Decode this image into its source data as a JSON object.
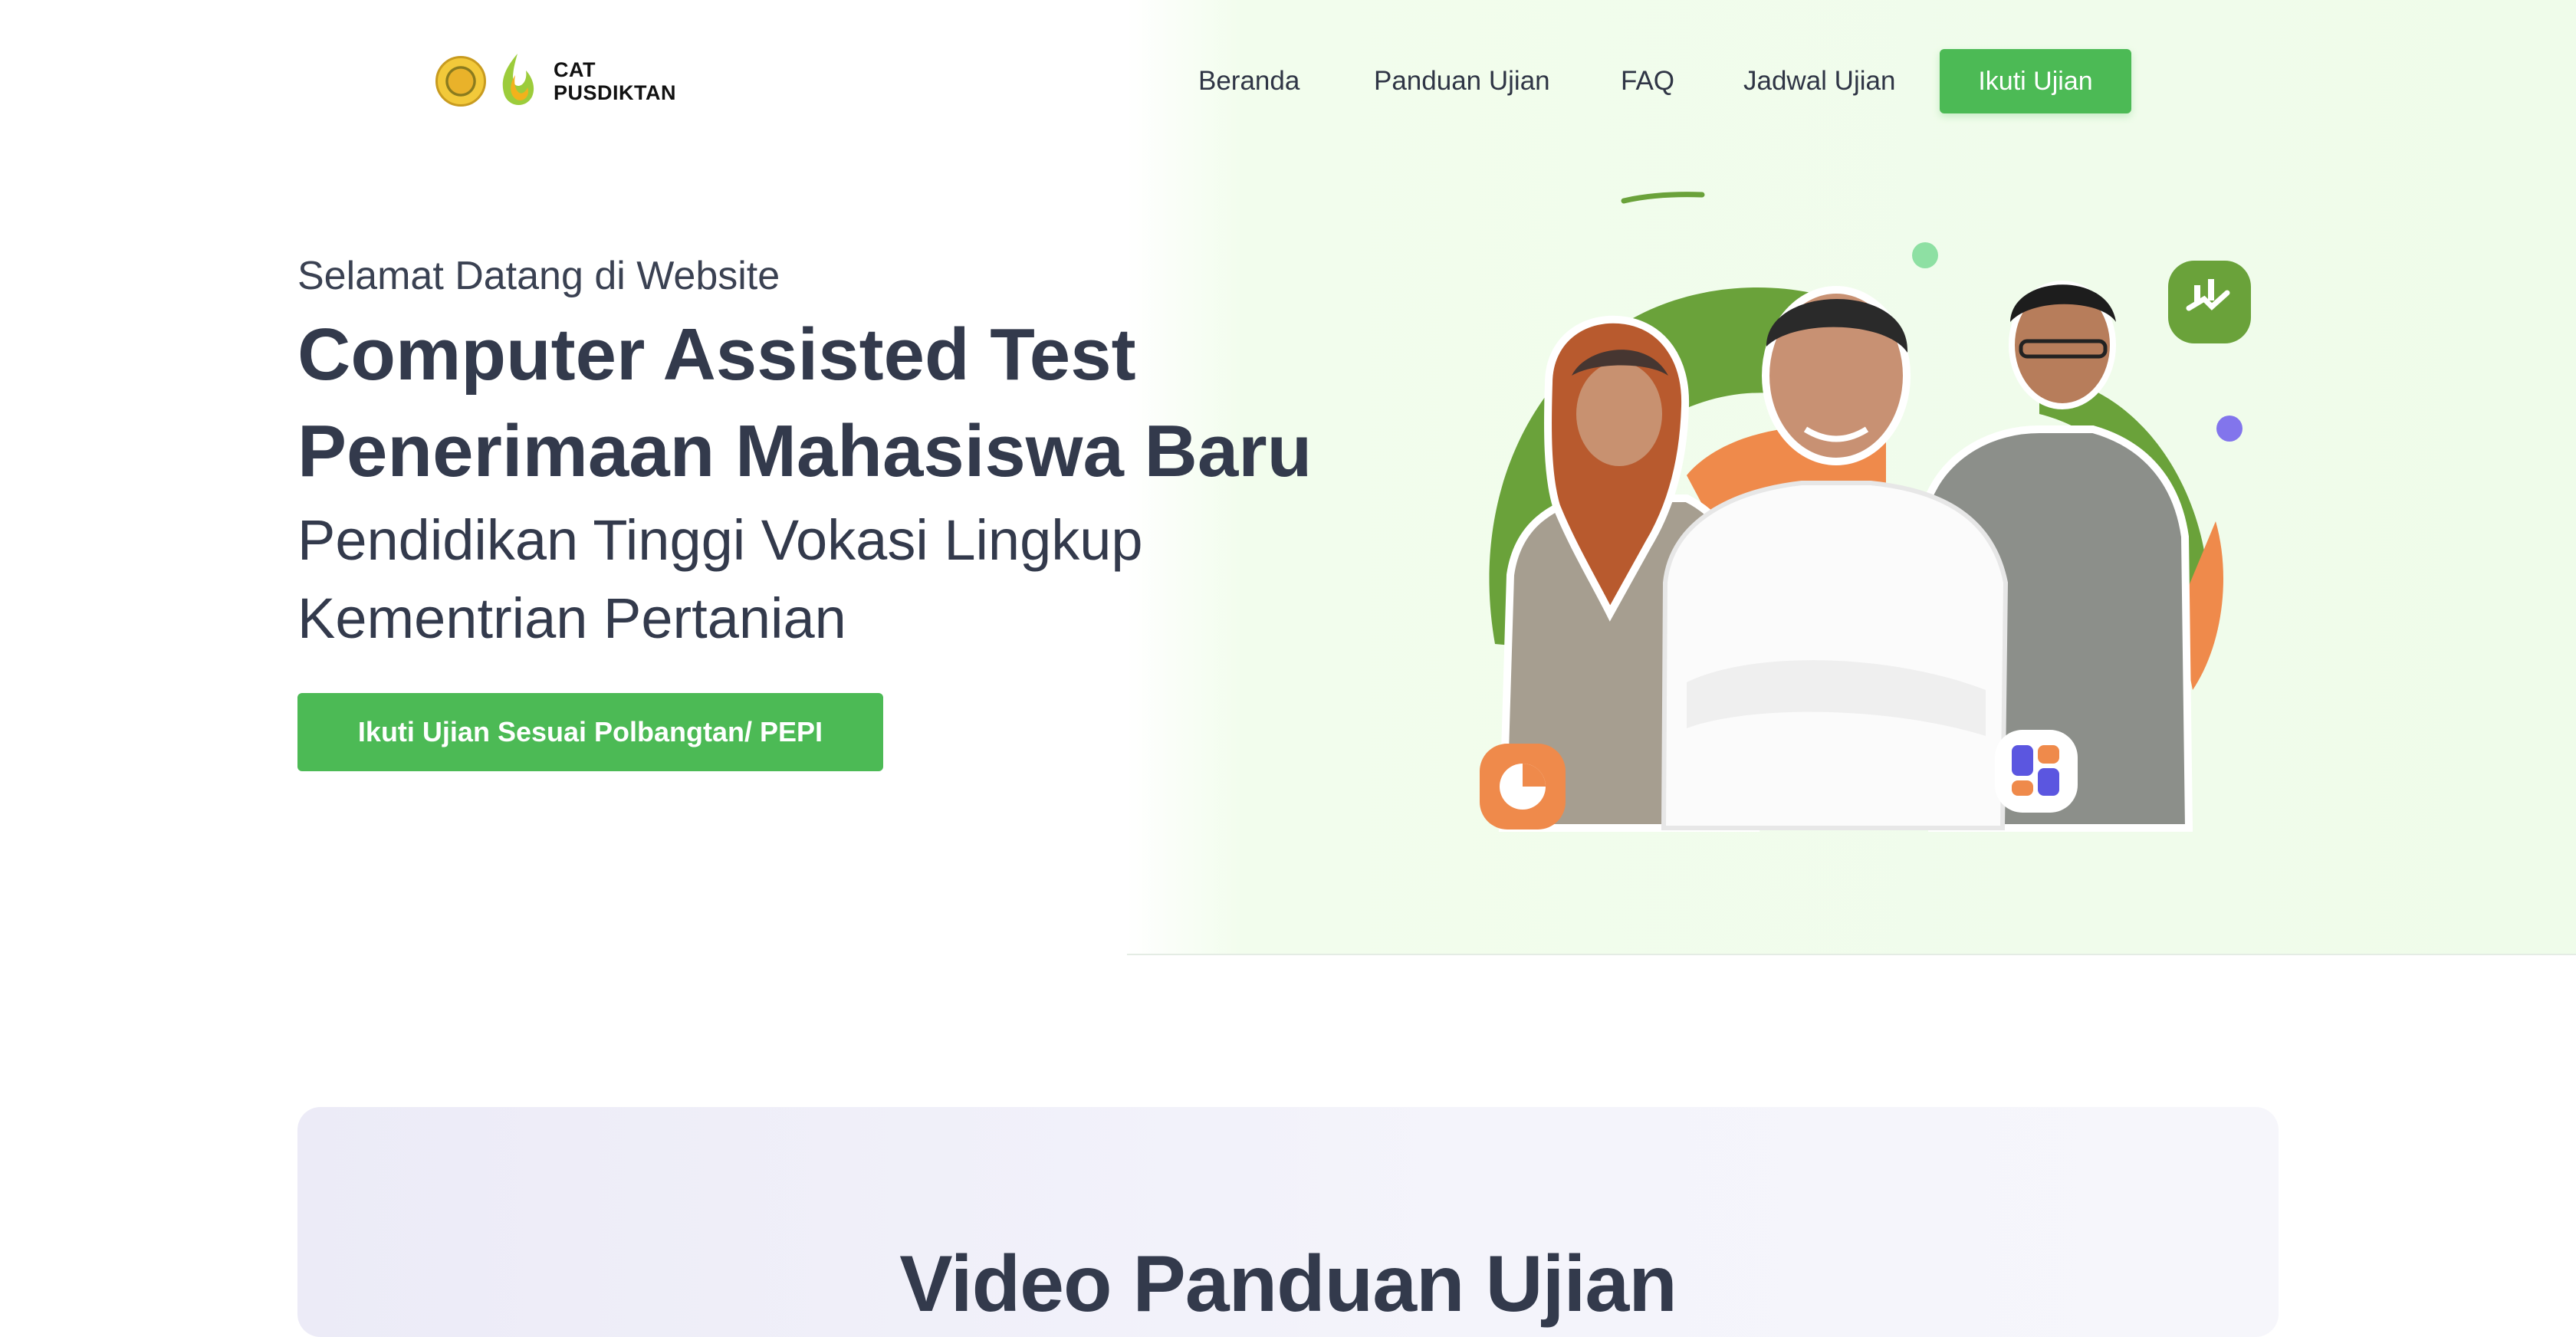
{
  "brand": {
    "line1": "CAT",
    "line2": "PUSDIKTAN"
  },
  "nav": {
    "items": [
      {
        "label": "Beranda"
      },
      {
        "label": "Panduan Ujian"
      },
      {
        "label": "FAQ"
      },
      {
        "label": "Jadwal Ujian"
      }
    ],
    "cta_label": "Ikuti Ujian"
  },
  "hero": {
    "welcome": "Selamat Datang di Website",
    "title_line1": "Computer Assisted Test",
    "title_line2": "Penerimaan Mahasiswa Baru",
    "subtitle_line1": "Pendidikan Tinggi Vokasi Lingkup",
    "subtitle_line2": "Kementrian Pertanian",
    "cta_label": "Ikuti Ujian Sesuai Polbangtan/ PEPI"
  },
  "video_section": {
    "title": "Video Panduan Ujian"
  },
  "colors": {
    "accent": "#4cba55",
    "text": "#333a4c",
    "hero_bg": "#effcea",
    "orange": "#ef8a4b",
    "green_dark": "#6aa23a",
    "purple": "#7b6cf0"
  },
  "icons": [
    "logo-seal",
    "logo-flame",
    "hand-chart-icon",
    "pie-chart-icon",
    "dashboard-grid-icon"
  ]
}
